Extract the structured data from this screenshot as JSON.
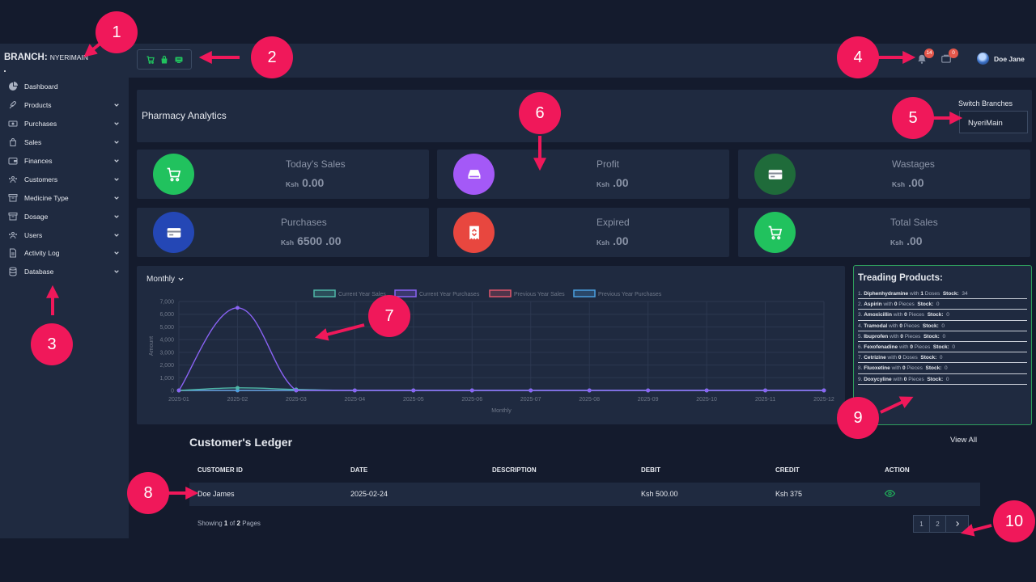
{
  "branch": {
    "label": "BRANCH:",
    "name": "NYERIMAIN"
  },
  "sidebar": {
    "items": [
      {
        "label": "Dashboard",
        "icon": "dashboard-icon",
        "has_submenu": false
      },
      {
        "label": "Products",
        "icon": "pill-icon",
        "has_submenu": true
      },
      {
        "label": "Purchases",
        "icon": "money-icon",
        "has_submenu": true
      },
      {
        "label": "Sales",
        "icon": "bag-icon",
        "has_submenu": true
      },
      {
        "label": "Finances",
        "icon": "wallet-icon",
        "has_submenu": true
      },
      {
        "label": "Customers",
        "icon": "users-icon",
        "has_submenu": true
      },
      {
        "label": "Medicine Type",
        "icon": "archive-icon",
        "has_submenu": true
      },
      {
        "label": "Dosage",
        "icon": "archive-icon",
        "has_submenu": true
      },
      {
        "label": "Users",
        "icon": "users-icon",
        "has_submenu": true
      },
      {
        "label": "Activity Log",
        "icon": "file-icon",
        "has_submenu": true
      },
      {
        "label": "Database",
        "icon": "database-icon",
        "has_submenu": true
      }
    ]
  },
  "header": {
    "quick_actions": [
      "cart-icon",
      "bag-icon",
      "receipt-icon"
    ],
    "notifications_count": "14",
    "cart_count": "0",
    "user_name": "Doe Jane"
  },
  "analytics": {
    "title": "Pharmacy Analytics",
    "switch_label": "Switch Branches",
    "branch_selected": "NyeriMain"
  },
  "stats": [
    {
      "label": "Today's Sales",
      "currency": "Ksh",
      "amount": "0.00",
      "color": "#21c25e",
      "icon": "cart-icon"
    },
    {
      "label": "Profit",
      "currency": "Ksh",
      "amount": ".00",
      "color": "#a459f7",
      "icon": "drive-icon"
    },
    {
      "label": "Wastages",
      "currency": "Ksh",
      "amount": ".00",
      "color": "#1f6b3a",
      "icon": "card-icon"
    },
    {
      "label": "Purchases",
      "currency": "Ksh",
      "amount": "6500 .00",
      "color": "#2447b5",
      "icon": "card-icon"
    },
    {
      "label": "Expired",
      "currency": "Ksh",
      "amount": ".00",
      "color": "#e8473f",
      "icon": "receipt-icon"
    },
    {
      "label": "Total Sales",
      "currency": "Ksh",
      "amount": ".00",
      "color": "#21c25e",
      "icon": "cart-icon"
    }
  ],
  "chart_filter": "Monthly",
  "chart_data": {
    "type": "line",
    "categories": [
      "2025-01",
      "2025-02",
      "2025-03",
      "2025-04",
      "2025-05",
      "2025-06",
      "2025-07",
      "2025-08",
      "2025-09",
      "2025-10",
      "2025-11",
      "2025-12"
    ],
    "series": [
      {
        "name": "Current Year Sales",
        "color": "#4fb8a8",
        "values": [
          0,
          200,
          80,
          0,
          0,
          0,
          0,
          0,
          0,
          0,
          0,
          0
        ]
      },
      {
        "name": "Current Year Purchases",
        "color": "#8a63f5",
        "values": [
          0,
          6500,
          0,
          0,
          0,
          0,
          0,
          0,
          0,
          0,
          0,
          0
        ]
      },
      {
        "name": "Previous Year Sales",
        "color": "#e0566c",
        "values": [
          0,
          0,
          0,
          0,
          0,
          0,
          0,
          0,
          0,
          0,
          0,
          0
        ]
      },
      {
        "name": "Previous Year Purchases",
        "color": "#4a9fe0",
        "values": [
          0,
          0,
          0,
          0,
          0,
          0,
          0,
          0,
          0,
          0,
          0,
          0
        ]
      }
    ],
    "xlabel": "Monthly",
    "ylabel": "Amount",
    "ylim": [
      0,
      7000
    ],
    "yticks": [
      "7,000",
      "6,000",
      "5,000",
      "4,000",
      "3,000",
      "2,000",
      "1,000",
      "0"
    ],
    "legend": "top",
    "grid": true
  },
  "trending": {
    "title": "Treading Products:",
    "items": [
      {
        "idx": "1.",
        "name": "Diphenhydramine",
        "with": "with",
        "qty": "1",
        "unit": "Doses",
        "stock_label": "Stock:",
        "stock": "34"
      },
      {
        "idx": "2.",
        "name": "Aspirin",
        "with": "with",
        "qty": "0",
        "unit": "Pieces",
        "stock_label": "Stock:",
        "stock": "0"
      },
      {
        "idx": "3.",
        "name": "Amoxicillin",
        "with": "with",
        "qty": "0",
        "unit": "Pieces",
        "stock_label": "Stock:",
        "stock": "0"
      },
      {
        "idx": "4.",
        "name": "Tramodal",
        "with": "with",
        "qty": "0",
        "unit": "Pieces",
        "stock_label": "Stock:",
        "stock": "0"
      },
      {
        "idx": "5.",
        "name": "Ibuprofen",
        "with": "with",
        "qty": "0",
        "unit": "Pieces",
        "stock_label": "Stock:",
        "stock": "0"
      },
      {
        "idx": "6.",
        "name": "Fexofenadine",
        "with": "with",
        "qty": "0",
        "unit": "Pieces",
        "stock_label": "Stock:",
        "stock": "0"
      },
      {
        "idx": "7.",
        "name": "Cetrizine",
        "with": "with",
        "qty": "0",
        "unit": "Doses",
        "stock_label": "Stock:",
        "stock": "0"
      },
      {
        "idx": "8.",
        "name": "Fluoxetine",
        "with": "with",
        "qty": "0",
        "unit": "Pieces",
        "stock_label": "Stock:",
        "stock": "0"
      },
      {
        "idx": "9.",
        "name": "Doxycyline",
        "with": "with",
        "qty": "0",
        "unit": "Pieces",
        "stock_label": "Stock:",
        "stock": "0"
      }
    ]
  },
  "ledger": {
    "title": "Customer's Ledger",
    "view_all": "View All",
    "columns": [
      "CUSTOMER ID",
      "DATE",
      "DESCRIPTION",
      "DEBIT",
      "CREDIT",
      "ACTION"
    ],
    "rows": [
      {
        "customer": "Doe James",
        "date": "2025-02-24",
        "description": "",
        "debit": "Ksh 500.00",
        "credit": "Ksh 375",
        "action": "eye-icon"
      }
    ],
    "showing_prefix": "Showing",
    "showing_current": "1",
    "showing_mid": "of",
    "showing_total": "2",
    "showing_suffix": "Pages",
    "pages": [
      "1",
      "2"
    ],
    "next": "›"
  },
  "annotations": [
    "1",
    "2",
    "3",
    "4",
    "5",
    "6",
    "7",
    "8",
    "9",
    "10"
  ],
  "colors": {
    "background": "#141b2d",
    "panel": "#1f2a40",
    "accent_pink": "#f0185a",
    "green": "#21c25e"
  }
}
